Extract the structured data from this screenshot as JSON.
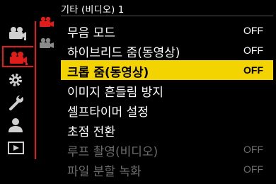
{
  "header": {
    "title": "기타 (비디오) 1"
  },
  "side_tabs": [
    {
      "icon": "photo-camera-icon",
      "active": false
    },
    {
      "icon": "video-camera-icon",
      "active": true
    },
    {
      "icon": "gear-icon",
      "active": false
    },
    {
      "icon": "wrench-icon",
      "active": false
    },
    {
      "icon": "person-icon",
      "active": false
    },
    {
      "icon": "play-icon",
      "active": false
    }
  ],
  "page_icons": [
    {
      "icon": "video-camera-icon",
      "active": true
    },
    {
      "icon": "video-camera-icon",
      "active": false
    }
  ],
  "menu": [
    {
      "label": "무음 모드",
      "value": "OFF",
      "state": "normal"
    },
    {
      "label": "하이브리드 줌(동영상)",
      "value": "OFF",
      "state": "normal"
    },
    {
      "label": "크롭 줌(동영상)",
      "value": "OFF",
      "state": "selected"
    },
    {
      "label": "이미지 흔들림 방지",
      "value": "",
      "state": "normal"
    },
    {
      "label": "셀프타이머 설정",
      "value": "",
      "state": "normal"
    },
    {
      "label": "초점 전환",
      "value": "",
      "state": "normal"
    },
    {
      "label": "루프 촬영(비디오)",
      "value": "OFF",
      "state": "disabled"
    },
    {
      "label": "파일 분할 녹화",
      "value": "OFF",
      "state": "disabled"
    }
  ],
  "colors": {
    "accent": "#e21b1b",
    "highlight": "#f4d400",
    "disabled": "#6d6d6d"
  }
}
